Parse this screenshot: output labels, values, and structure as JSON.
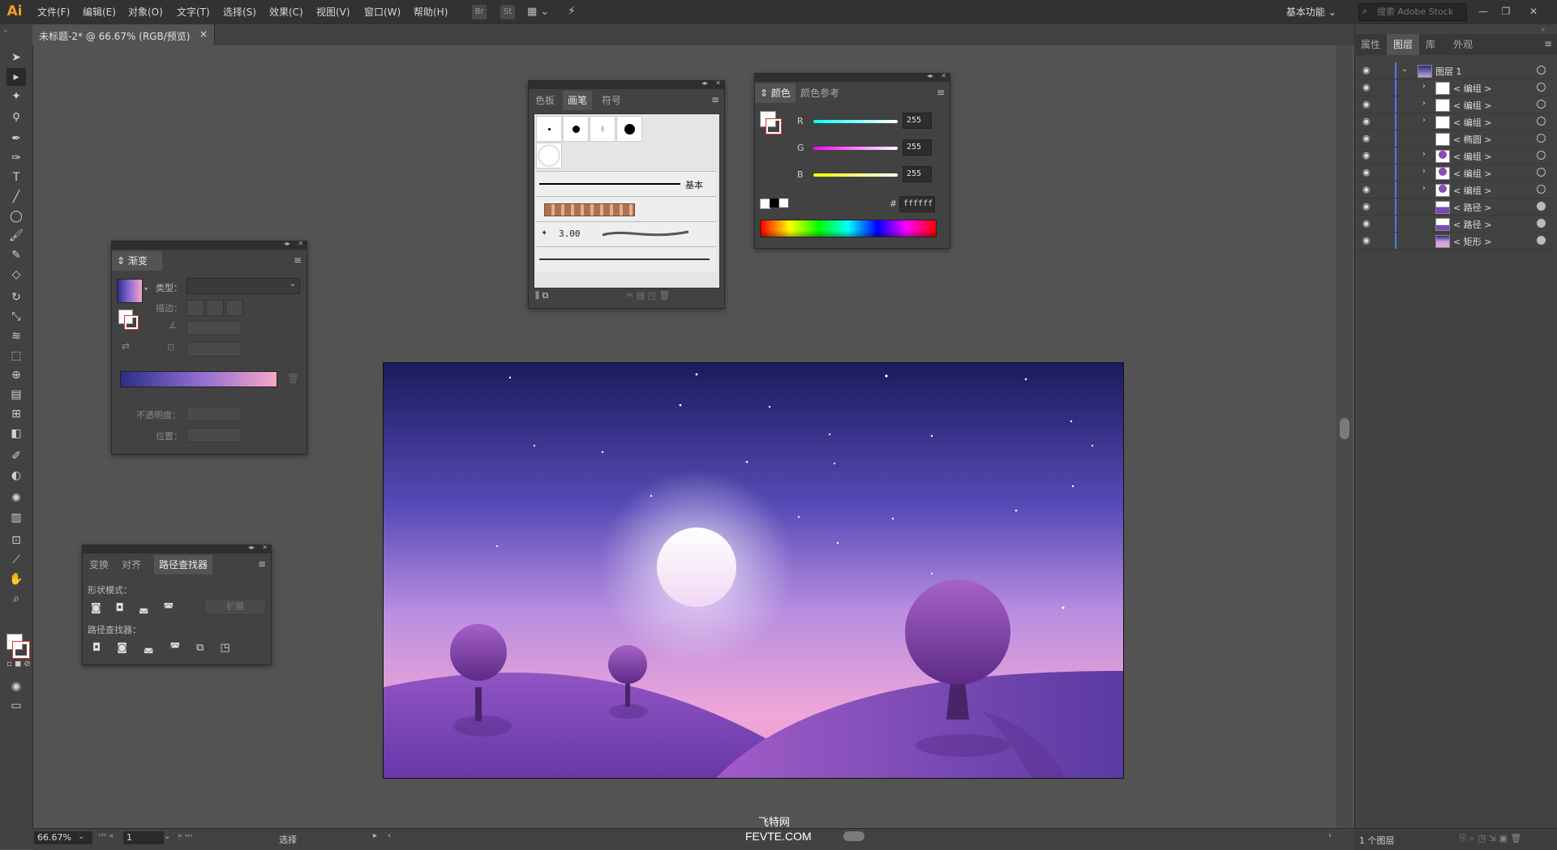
{
  "app": {
    "logo": "Ai"
  },
  "menu": [
    "文件(F)",
    "编辑(E)",
    "对象(O)",
    "文字(T)",
    "选择(S)",
    "效果(C)",
    "视图(V)",
    "窗口(W)",
    "帮助(H)"
  ],
  "menubar_buttons": {
    "bridge": "Br",
    "stock": "St"
  },
  "workspace_label": "基本功能",
  "search_placeholder": "搜索 Adobe Stock",
  "document_tab": {
    "title": "未标题-2* @ 66.67% (RGB/预览)",
    "close": "×"
  },
  "gradient_panel": {
    "title": "渐变",
    "type_label": "类型：",
    "stroke_label": "描边：",
    "opacity_label": "不透明度：",
    "position_label": "位置：",
    "gradient_start": "#2b2f86",
    "gradient_mid": "#8e6cd0",
    "gradient_end": "#f6a7c8"
  },
  "brush_panel": {
    "tabs": [
      "色板",
      "画笔",
      "符号"
    ],
    "active_tab": "画笔",
    "basic_label": "基本",
    "size_value": "3.00"
  },
  "color_panel": {
    "tabs": [
      "颜色",
      "颜色参考"
    ],
    "active_tab": "颜色",
    "channels": [
      {
        "label": "R",
        "value": "255"
      },
      {
        "label": "G",
        "value": "255"
      },
      {
        "label": "B",
        "value": "255"
      }
    ],
    "hex_prefix": "#",
    "hex_value": "ffffff"
  },
  "pathfinder_panel": {
    "tabs": [
      "变换",
      "对齐",
      "路径查找器"
    ],
    "active_tab": "路径查找器",
    "shape_modes_label": "形状模式：",
    "expand_label": "扩展",
    "pathfinders_label": "路径查找器："
  },
  "layers_panel": {
    "tabs": [
      "属性",
      "图层",
      "库",
      "外观"
    ],
    "active_tab": "图层",
    "layers": [
      {
        "name": "图层 1",
        "type": "layer",
        "expanded": true,
        "target": "open"
      },
      {
        "name": "< 编组 >",
        "type": "group",
        "thumb": "white",
        "target": "open"
      },
      {
        "name": "< 编组 >",
        "type": "group",
        "thumb": "white",
        "target": "open"
      },
      {
        "name": "< 编组 >",
        "type": "group",
        "thumb": "white",
        "target": "open"
      },
      {
        "name": "< 椭圆 >",
        "type": "item",
        "thumb": "white",
        "target": "open"
      },
      {
        "name": "< 编组 >",
        "type": "group",
        "thumb": "tree",
        "target": "open"
      },
      {
        "name": "< 编组 >",
        "type": "group",
        "thumb": "tree",
        "target": "open"
      },
      {
        "name": "< 编组 >",
        "type": "group",
        "thumb": "tree",
        "target": "open"
      },
      {
        "name": "< 路径 >",
        "type": "item",
        "thumb": "hill",
        "target": "filled"
      },
      {
        "name": "< 路径 >",
        "type": "item",
        "thumb": "hill",
        "target": "filled"
      },
      {
        "name": "< 矩形 >",
        "type": "item",
        "thumb": "sky",
        "target": "filled"
      }
    ],
    "footer": "1 个图层"
  },
  "status": {
    "zoom": "66.67%",
    "page": "1",
    "tool": "选择"
  },
  "watermark": {
    "cn": "飞特网",
    "en": "FEVTE.COM"
  },
  "colors": {
    "sky_top": "#1e1f62",
    "sky_mid": "#7b5fc4",
    "sky_low": "#e89bd0",
    "hill_purple": "#7a48b8",
    "tree_purple": "#8b4eb0",
    "accent_blue": "#4a7cff"
  }
}
